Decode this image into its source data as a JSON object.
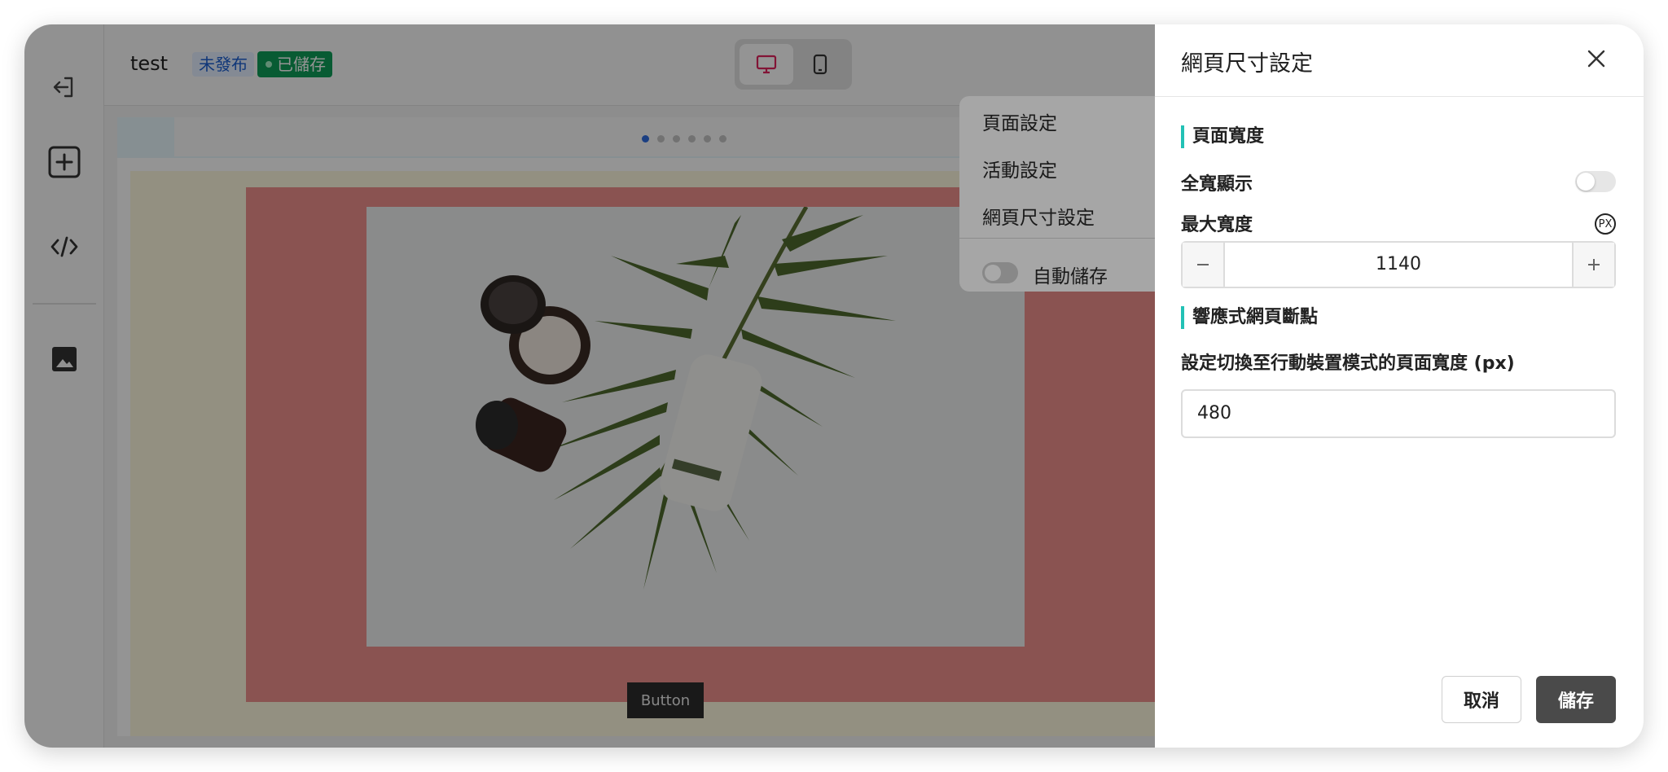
{
  "header": {
    "title": "test",
    "status_unpublished": "未發布",
    "status_saved": "已儲存",
    "device_options": [
      "desktop-icon",
      "mobile-icon"
    ],
    "active_device": "desktop"
  },
  "sidebar": {
    "items": [
      {
        "icon": "exit-icon"
      },
      {
        "icon": "add-block-icon"
      },
      {
        "icon": "code-icon"
      },
      {
        "icon": "image-icon"
      }
    ]
  },
  "canvas": {
    "slider_dots_count": 6,
    "active_dot": 1,
    "button_label": "Button",
    "image_alt": "Skincare products on a palm leaf",
    "colors": {
      "strip": "#e7f6fb",
      "section_bg": "#fdf8de",
      "card_bg": "#ee8f8c"
    }
  },
  "menu": {
    "items": [
      "頁面設定",
      "活動設定",
      "網頁尺寸設定"
    ],
    "autosave_label": "自動儲存",
    "autosave_on": false
  },
  "panel": {
    "title": "網頁尺寸設定",
    "section_width": "頁面寬度",
    "fullwidth_label": "全寬顯示",
    "fullwidth_on": false,
    "max_width_label": "最大寬度",
    "unit": "PX",
    "max_width_value": "1140",
    "section_breakpoint": "響應式網頁斷點",
    "breakpoint_label": "設定切換至行動裝置模式的頁面寬度 (px)",
    "breakpoint_value": "480",
    "cancel_label": "取消",
    "save_label": "儲存",
    "accent_color": "#22c1b5"
  }
}
